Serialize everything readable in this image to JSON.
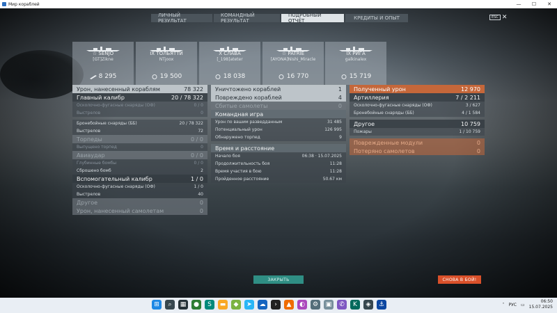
{
  "window": {
    "title": "Мир кораблей",
    "min": "—",
    "max": "☐",
    "close": "✕"
  },
  "tabs": [
    "ЛИЧНЫЙ РЕЗУЛЬТАТ",
    "КОМАНДНЫЙ РЕЗУЛЬТАТ",
    "ПОДРОБНЫЙ ОТЧЁТ",
    "КРЕДИТЫ И ОПЫТ"
  ],
  "esc": {
    "key": "ESC",
    "close": "✕"
  },
  "ships": [
    {
      "name": "SENJŌ",
      "tier": "☆",
      "player": "[GT]Zikne",
      "xp": "8 295",
      "icon": "torpedo-hit-icon"
    },
    {
      "name": "IX ТОЛЬЯТТИ",
      "tier": "",
      "player": "NTjoox",
      "xp": "19 500",
      "icon": "crosshair-icon"
    },
    {
      "name": "X СЛАВА",
      "tier": "",
      "player": "[_198]ateter",
      "xp": "18 038",
      "icon": "crosshair-icon"
    },
    {
      "name": "PATRIE",
      "tier": "☆",
      "player": "[AYONA]Nishi_Miracle",
      "xp": "16 770",
      "icon": "crosshair-icon"
    },
    {
      "name": "IX РИГА",
      "tier": "",
      "player": "galkinalex",
      "xp": "15 719",
      "icon": "crosshair-icon"
    }
  ],
  "left": {
    "dmg_ships": {
      "label": "Урон, нанесенный кораблям",
      "value": "78 322"
    },
    "main": {
      "label": "Главный калибр",
      "value": "20 / 78 322"
    },
    "main_he": {
      "label": "Осколочно-фугасные снаряды (ОФ)",
      "value": "0 / 0"
    },
    "main_he_shots": {
      "label": "Выстрелов",
      "value": "0"
    },
    "main_ap": {
      "label": "Бронебойные снаряды (ББ)",
      "value": "20 / 78 322"
    },
    "main_ap_shots": {
      "label": "Выстрелов",
      "value": "72"
    },
    "torp": {
      "label": "Торпеды",
      "value": "0 / 0"
    },
    "torp_shots": {
      "label": "Выпущено торпед",
      "value": "0"
    },
    "air": {
      "label": "Авиаудар",
      "value": "0 / 0"
    },
    "air_depth": {
      "label": "Глубинные бомбы",
      "value": "0 / 0"
    },
    "air_dropped": {
      "label": "Сброшено бомб",
      "value": "2"
    },
    "sec": {
      "label": "Вспомогательный калибр",
      "value": "1 / 0"
    },
    "sec_he": {
      "label": "Осколочно-фугасные снаряды (ОФ)",
      "value": "1 / 0"
    },
    "sec_shots": {
      "label": "Выстрелов",
      "value": "40"
    },
    "other": {
      "label": "Другое",
      "value": "0"
    },
    "dmg_planes": {
      "label": "Урон, нанесенный самолетам",
      "value": "0"
    }
  },
  "middle": {
    "destroyed": {
      "label": "Уничтожено кораблей",
      "value": "1"
    },
    "damaged": {
      "label": "Повреждено кораблей",
      "value": "4"
    },
    "planes": {
      "label": "Сбитые самолеты",
      "value": "0"
    },
    "team": {
      "label": "Командная игра"
    },
    "spotting": {
      "label": "Урон по вашим разведданным",
      "value": "31 485"
    },
    "potential": {
      "label": "Потенциальный урон",
      "value": "126 995"
    },
    "torp_spotted": {
      "label": "Обнаружено торпед",
      "value": "9"
    },
    "time": {
      "label": "Время и расстояние"
    },
    "start": {
      "label": "Начало боя",
      "value": "06:38 · 15.07.2025"
    },
    "duration": {
      "label": "Продолжительность боя",
      "value": "11:28"
    },
    "in_battle": {
      "label": "Время участия в бою",
      "value": "11:28"
    },
    "distance": {
      "label": "Пройденное расстояние",
      "value": "50.67 км"
    }
  },
  "right": {
    "received": {
      "label": "Полученный урон",
      "value": "12 970"
    },
    "artillery": {
      "label": "Артиллерия",
      "value": "7 / 2 211"
    },
    "he": {
      "label": "Осколочно-фугасные снаряды (ОФ)",
      "value": "3 / 627"
    },
    "ap": {
      "label": "Бронебойные снаряды (ББ)",
      "value": "4 / 1 584"
    },
    "other": {
      "label": "Другое",
      "value": "10 759"
    },
    "fires": {
      "label": "Пожары",
      "value": "1 / 10 759"
    },
    "modules": {
      "label": "Поврежденные модули",
      "value": "0"
    },
    "planes_lost": {
      "label": "Потеряно самолетов",
      "value": "0"
    }
  },
  "buttons": {
    "close": "ЗАКРЫТЬ",
    "battle": "СНОВА В БОЙ!"
  },
  "tray": {
    "lang": "РУС",
    "time": "06:50",
    "date": "15.07.2025"
  },
  "taskbar_icons": [
    "windows-icon",
    "search-icon",
    "file-explorer-icon",
    "chrome-icon",
    "skype-icon",
    "folder-icon",
    "telegram-icon",
    "onedrive-icon",
    "excel-icon",
    "vlc-icon",
    "paint-icon",
    "settings-icon",
    "cube-icon",
    "viber-icon",
    "kaspersky-icon",
    "game-icon",
    "wows-icon"
  ]
}
